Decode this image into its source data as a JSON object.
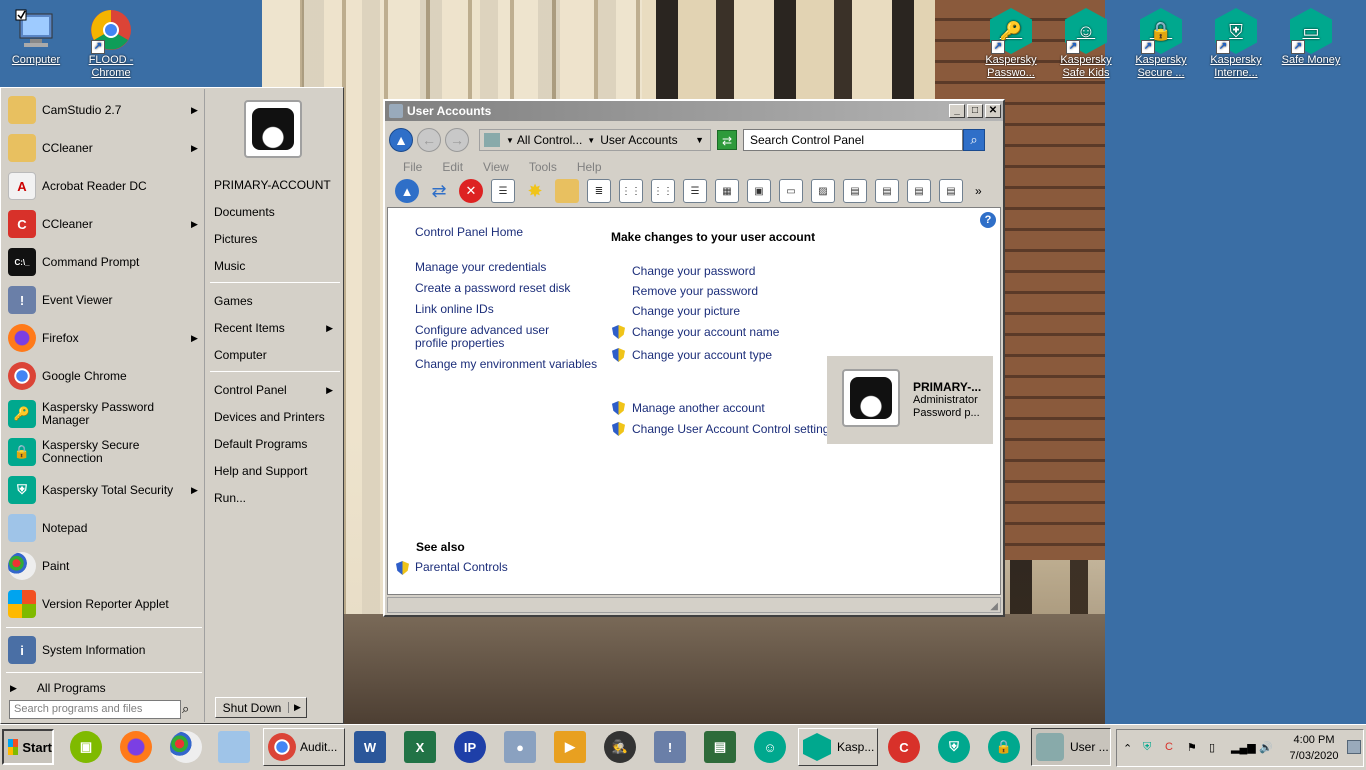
{
  "desktop": {
    "icons_left": [
      {
        "label": "Computer"
      },
      {
        "label": "FLOOD - Chrome"
      }
    ],
    "icons_right": [
      {
        "label": "Kaspersky Passwo..."
      },
      {
        "label": "Kaspersky Safe Kids"
      },
      {
        "label": "Kaspersky Secure ..."
      },
      {
        "label": "Kaspersky Interne..."
      },
      {
        "label": "Safe Money"
      }
    ]
  },
  "start_menu": {
    "programs": [
      {
        "label": "CamStudio 2.7",
        "has_arrow": true
      },
      {
        "label": "CCleaner",
        "has_arrow": true
      },
      {
        "label": "Acrobat Reader DC",
        "has_arrow": false
      },
      {
        "label": "CCleaner",
        "has_arrow": true
      },
      {
        "label": "Command Prompt",
        "has_arrow": false
      },
      {
        "label": "Event Viewer",
        "has_arrow": false
      },
      {
        "label": "Firefox",
        "has_arrow": true
      },
      {
        "label": "Google Chrome",
        "has_arrow": false
      },
      {
        "label": "Kaspersky Password Manager",
        "has_arrow": false
      },
      {
        "label": "Kaspersky Secure Connection",
        "has_arrow": false
      },
      {
        "label": "Kaspersky Total Security",
        "has_arrow": true
      },
      {
        "label": "Notepad",
        "has_arrow": false
      },
      {
        "label": "Paint",
        "has_arrow": false
      },
      {
        "label": "Version Reporter Applet",
        "has_arrow": false
      }
    ],
    "system_information": "System Information",
    "all_programs": "All Programs",
    "search_placeholder": "Search programs and files",
    "right_links": {
      "user": "PRIMARY-ACCOUNT",
      "documents": "Documents",
      "pictures": "Pictures",
      "music": "Music",
      "games": "Games",
      "recent_items": "Recent Items",
      "computer": "Computer",
      "control_panel": "Control Panel",
      "devices_printers": "Devices and Printers",
      "default_programs": "Default Programs",
      "help_support": "Help and Support",
      "run": "Run..."
    },
    "shutdown": "Shut Down"
  },
  "window": {
    "title": "User Accounts",
    "breadcrumb": {
      "part1": "All Control...",
      "part2": "User Accounts"
    },
    "search_placeholder": "Search Control Panel",
    "menu": {
      "file": "File",
      "edit": "Edit",
      "view": "View",
      "tools": "Tools",
      "help": "Help"
    },
    "left_panel": {
      "home": "Control Panel Home",
      "links": [
        "Manage your credentials",
        "Create a password reset disk",
        "Link online IDs",
        "Configure advanced user profile properties",
        "Change my environment variables"
      ],
      "see_also": "See also",
      "parental_controls": "Parental Controls"
    },
    "main": {
      "heading": "Make changes to your user account",
      "links": [
        "Change your password",
        "Remove your password",
        "Change your picture",
        "Change your account name",
        "Change your account type"
      ],
      "links2": [
        "Manage another account",
        "Change User Account Control settings"
      ]
    },
    "user_card": {
      "name": "PRIMARY-...",
      "role": "Administrator",
      "status": "Password p..."
    }
  },
  "taskbar": {
    "start": "Start",
    "tasks": [
      {
        "label": "Audit..."
      },
      {
        "label": "Kasp..."
      },
      {
        "label": "User ..."
      }
    ],
    "clock": {
      "time": "4:00 PM",
      "date": "7/03/2020"
    }
  }
}
